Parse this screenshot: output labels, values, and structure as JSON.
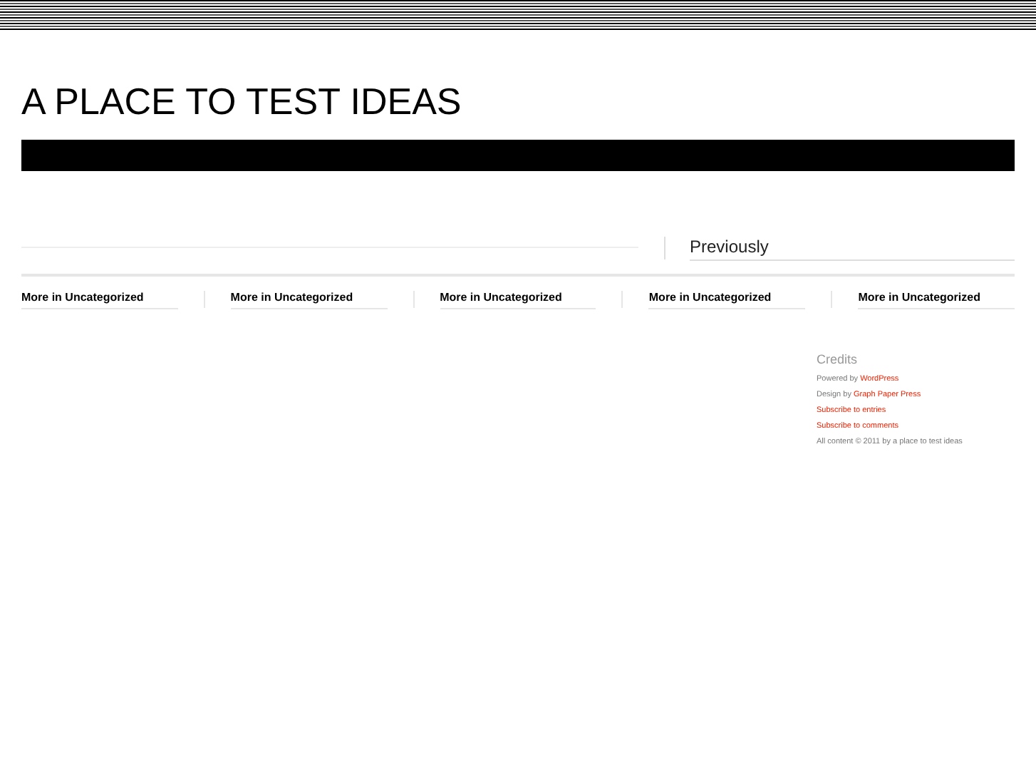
{
  "site_title": "A PLACE TO TEST IDEAS",
  "previously": {
    "heading": "Previously"
  },
  "sections": [
    {
      "heading": "More in Uncategorized"
    },
    {
      "heading": "More in Uncategorized"
    },
    {
      "heading": "More in Uncategorized"
    },
    {
      "heading": "More in Uncategorized"
    },
    {
      "heading": "More in Uncategorized"
    }
  ],
  "credits": {
    "title": "Credits",
    "lines": [
      {
        "kind": "mixed",
        "text": "Powered by",
        "link": "WordPress"
      },
      {
        "kind": "mixed",
        "text": "Design by",
        "link": "Graph Paper Press"
      },
      {
        "kind": "link",
        "link": "Subscribe to entries"
      },
      {
        "kind": "link",
        "link": "Subscribe to comments"
      },
      {
        "kind": "plain",
        "text": "All content © 2011 by a place to test ideas"
      }
    ]
  }
}
